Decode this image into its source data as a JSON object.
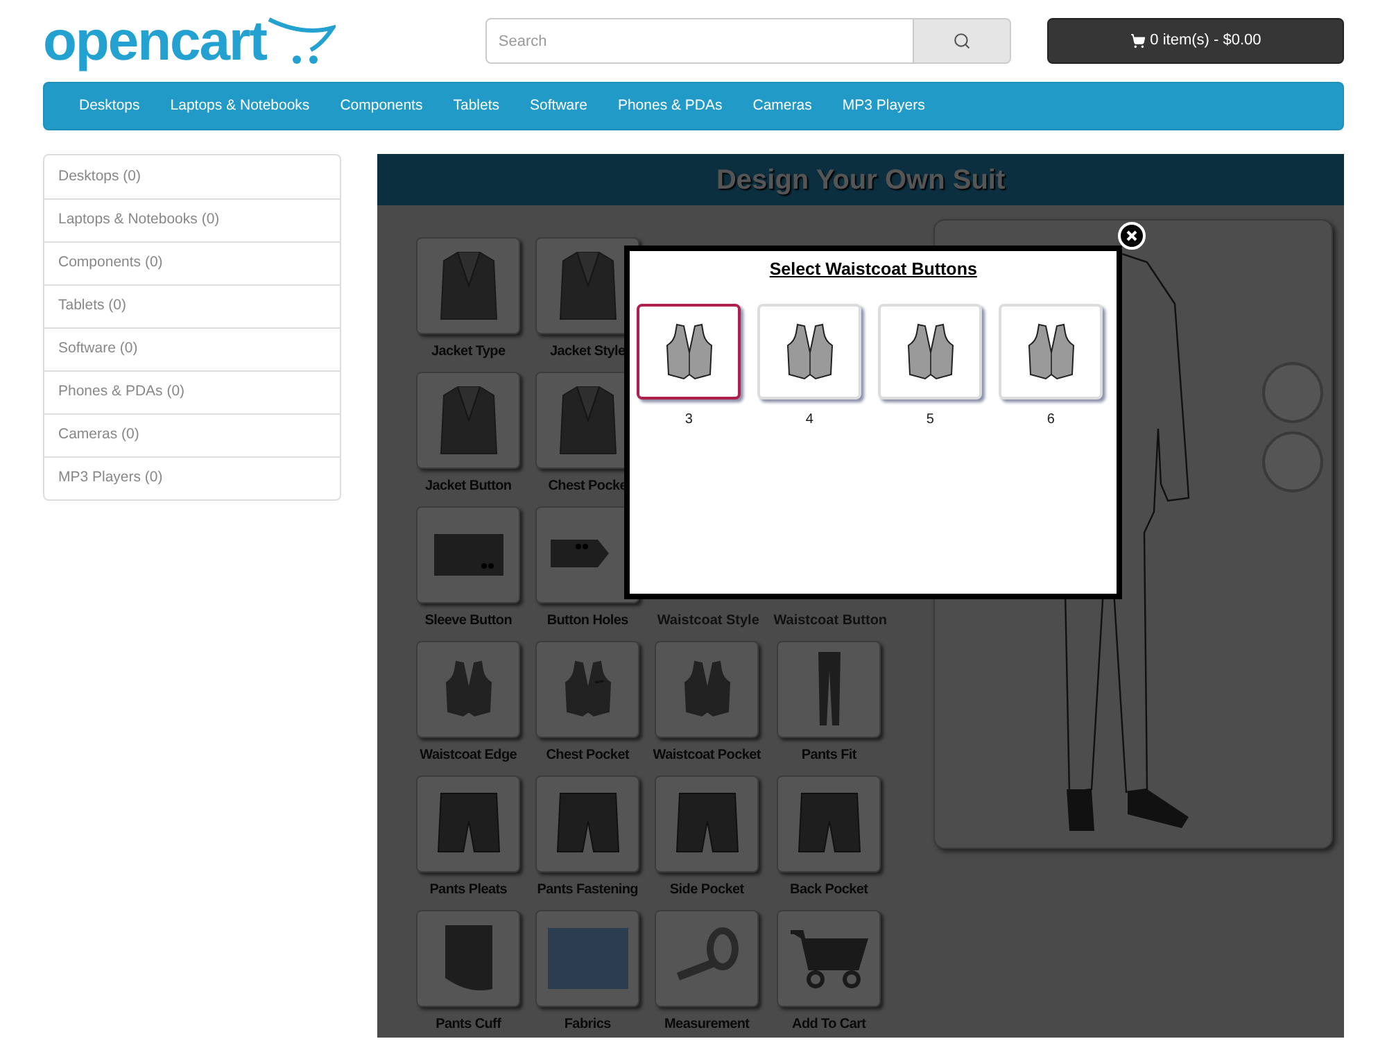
{
  "header": {
    "logo": "opencart",
    "search": {
      "placeholder": "Search"
    },
    "cart_button": "0 item(s) - $0.00"
  },
  "nav": [
    "Desktops",
    "Laptops & Notebooks",
    "Components",
    "Tablets",
    "Software",
    "Phones & PDAs",
    "Cameras",
    "MP3 Players"
  ],
  "sidebar": {
    "items": [
      {
        "label": "Desktops (0)",
        "selected": false
      },
      {
        "label": "Laptops & Notebooks (0)",
        "selected": false
      },
      {
        "label": "Components (0)",
        "selected": false
      },
      {
        "label": "Tablets (0)",
        "selected": false
      },
      {
        "label": "Software (0)",
        "selected": false
      },
      {
        "label": "Phones & PDAs (0)",
        "selected": false
      },
      {
        "label": "Cameras (0)",
        "selected": false
      },
      {
        "label": "MP3 Players (0)",
        "selected": false
      }
    ]
  },
  "designer": {
    "title": "Design Your Own Suit",
    "options": [
      {
        "kind": "tile",
        "label": "Jacket Type"
      },
      {
        "kind": "tile",
        "label": "Jacket Style"
      },
      {
        "kind": "covered"
      },
      {
        "kind": "covered"
      },
      {
        "kind": "tile",
        "label": "Jacket Button"
      },
      {
        "kind": "tile",
        "label": "Chest Pocke"
      },
      {
        "kind": "covered"
      },
      {
        "kind": "covered"
      },
      {
        "kind": "tile",
        "label": "Sleeve Button"
      },
      {
        "kind": "tile",
        "label": "Button Holes"
      },
      {
        "kind": "label",
        "label": "Waistcoat Style"
      },
      {
        "kind": "label",
        "label": "Waistcoat Button"
      },
      {
        "kind": "tile",
        "label": "Waistcoat Edge"
      },
      {
        "kind": "tile",
        "label": "Chest Pocket"
      },
      {
        "kind": "tile",
        "label": "Waistcoat Pocket"
      },
      {
        "kind": "tile",
        "label": "Pants Fit"
      },
      {
        "kind": "tile",
        "label": "Pants Pleats"
      },
      {
        "kind": "tile",
        "label": "Pants Fastening"
      },
      {
        "kind": "tile",
        "label": "Side Pocket"
      },
      {
        "kind": "tile",
        "label": "Back Pocket"
      },
      {
        "kind": "tile",
        "label": "Pants Cuff"
      },
      {
        "kind": "tile",
        "label": "Fabrics"
      },
      {
        "kind": "tile",
        "label": "Measurement"
      },
      {
        "kind": "tile",
        "label": "Add To Cart"
      }
    ]
  },
  "modal": {
    "title": "Select Waistcoat Buttons",
    "choices": [
      {
        "label": "3",
        "selected": true
      },
      {
        "label": "4",
        "selected": false
      },
      {
        "label": "5",
        "selected": false
      },
      {
        "label": "6",
        "selected": false
      }
    ]
  }
}
